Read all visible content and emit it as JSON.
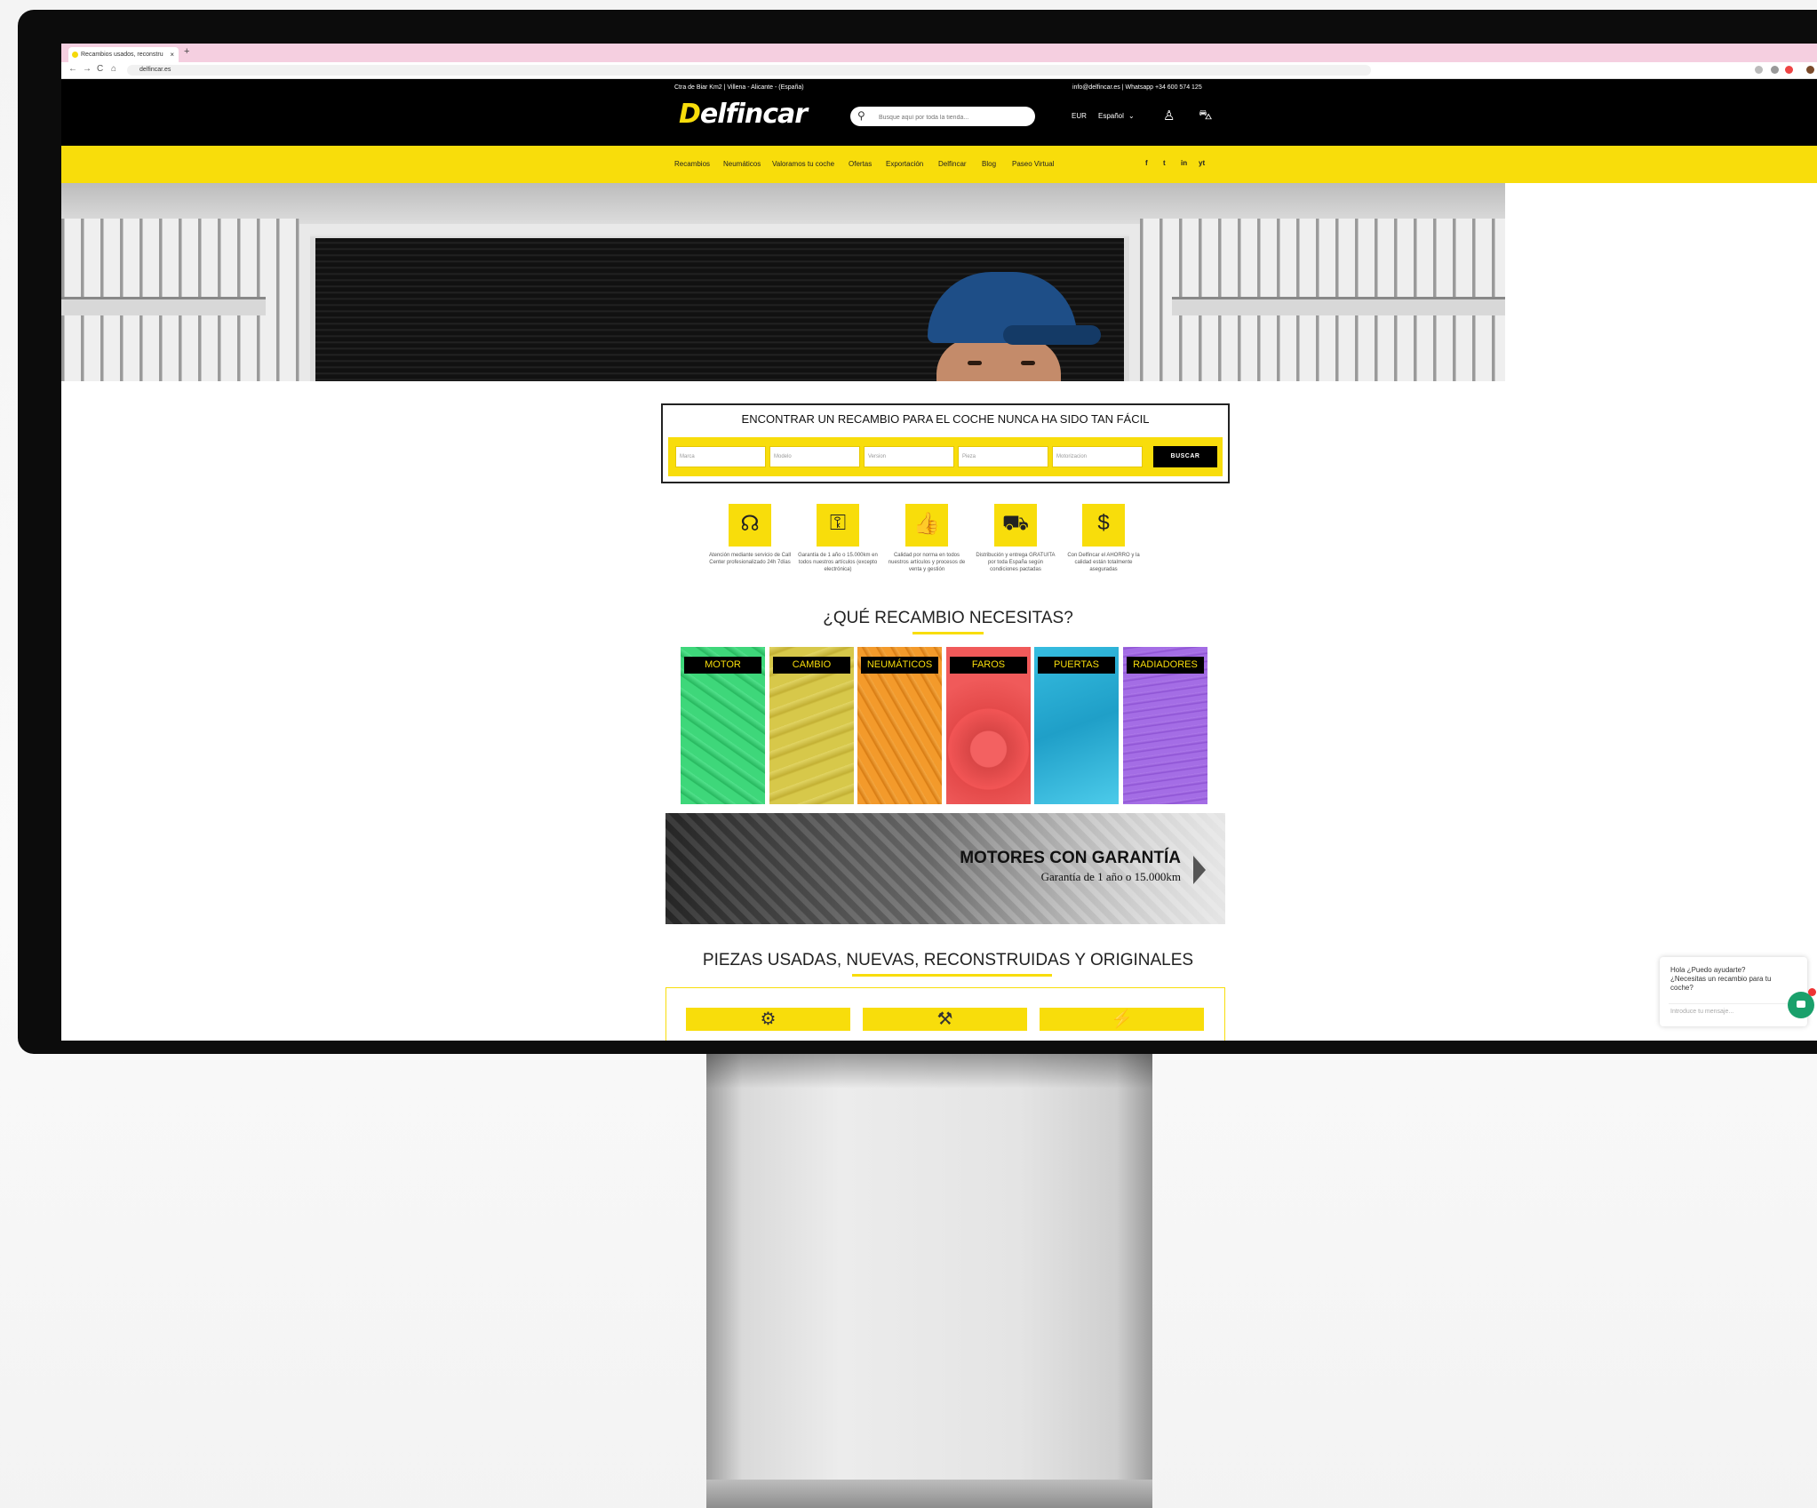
{
  "browser": {
    "tab_title": "Recambios usados, reconstru",
    "tab_close": "×",
    "new_tab": "+",
    "url": "delfincar.es",
    "nav": {
      "back": "←",
      "forward": "→",
      "reload": "C",
      "home": "⌂"
    }
  },
  "topbar": {
    "address": "Ctra de Biar Km2 | Villena - Alicante - (España)",
    "contact": "info@delfincar.es | Whatsapp +34 600 574 125"
  },
  "header": {
    "logo_initial": "D",
    "logo_rest": "elfincar",
    "search_placeholder": "Busque aquí por toda la tienda...",
    "currency": "EUR",
    "language": "Español"
  },
  "nav": {
    "items": [
      "Recambios",
      "Neumáticos",
      "Valoramos tu coche",
      "Ofertas",
      "Exportación",
      "Delfincar",
      "Blog",
      "Paseo Virtual"
    ],
    "social": [
      "f",
      "t",
      "in",
      "yt"
    ]
  },
  "finder": {
    "title": "ENCONTRAR UN RECAMBIO PARA EL COCHE NUNCA HA SIDO TAN FÁCIL",
    "fields": [
      "Marca",
      "Modelo",
      "Version",
      "Pieza",
      "Motorizacion"
    ],
    "button": "BUSCAR"
  },
  "features": [
    {
      "icon": "headset-icon",
      "glyph": "☊",
      "text": "Atención mediante servicio de Call Center profesionalizado 24h 7días"
    },
    {
      "icon": "certificate-icon",
      "glyph": "⚿",
      "text": "Garantía de 1 año o 15.000km en todos nuestros artículos (excepto electrónica)"
    },
    {
      "icon": "thumbs-up-icon",
      "glyph": "👍",
      "text": "Calidad por norma en todos nuestros artículos y procesos de venta y gestión"
    },
    {
      "icon": "delivery-truck-icon",
      "glyph": "⛟",
      "text": "Distribución y entrega GRATUITA por toda España según condiciones pactadas"
    },
    {
      "icon": "piggy-bank-icon",
      "glyph": "$",
      "text": "Con Delfincar el AHORRO y la calidad están totalmente aseguradas"
    }
  ],
  "categories_title": "¿QUÉ RECAMBIO NECESITAS?",
  "categories": [
    "MOTOR",
    "CAMBIO",
    "NEUMÁTICOS",
    "FAROS",
    "PUERTAS",
    "RADIADORES"
  ],
  "banner": {
    "title": "MOTORES CON GARANTÍA",
    "subtitle": "Garantía de 1 año o 15.000km"
  },
  "parts_title": "PIEZAS USADAS, NUEVAS, RECONSTRUIDAS Y ORIGINALES",
  "chat": {
    "message": "Hola ¿Puedo ayudarte? ¿Necesitas un recambio para tu coche?",
    "input_placeholder": "Introduce tu mensaje...",
    "badge": "1"
  },
  "colors": {
    "brand_yellow": "#f8dd0b",
    "header_black": "#000000",
    "chat_green": "#1aa06b"
  }
}
